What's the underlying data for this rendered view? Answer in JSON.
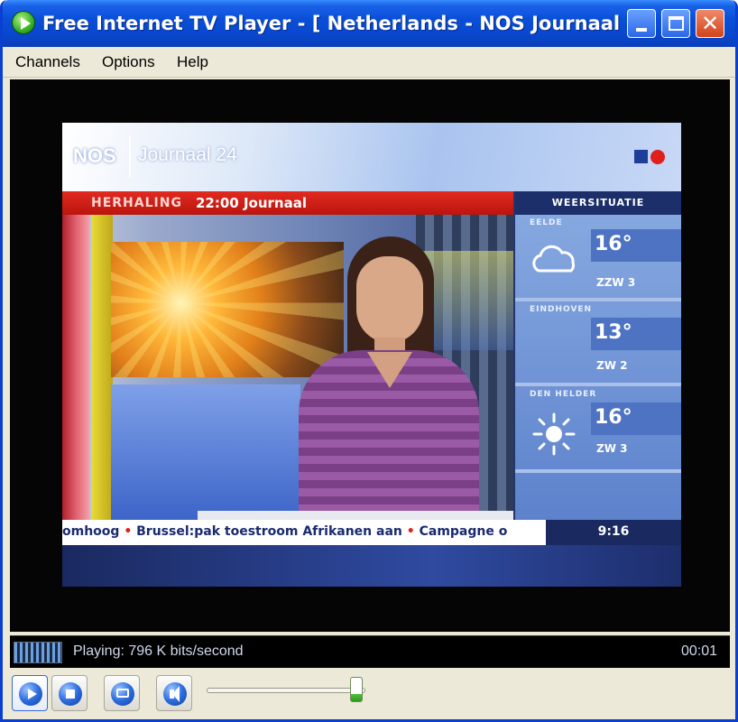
{
  "window": {
    "title": "Free Internet TV Player - [  Netherlands - NOS Journaal  (..."
  },
  "menu": {
    "items": [
      "Channels",
      "Options",
      "Help"
    ]
  },
  "broadcast": {
    "logo": "NOS",
    "channel_name": "Journaal 24",
    "banner_tag": "HERHALING",
    "banner_title": "22:00 Journaal",
    "weather_header": "WEERSITUATIE",
    "weather": [
      {
        "city": "EELDE",
        "temp": "16°",
        "wind": "ZZW 3",
        "icon": "cloud-icon"
      },
      {
        "city": "EINDHOVEN",
        "temp": "13°",
        "wind": "ZW 2",
        "icon": "none"
      },
      {
        "city": "DEN HELDER",
        "temp": "16°",
        "wind": "ZW 3",
        "icon": "sun-icon"
      }
    ],
    "ticker": [
      "omhoog",
      "Brussel:pak toestroom Afrikanen aan",
      "Campagne o"
    ],
    "ticker_separator": "•",
    "clock": "9:16"
  },
  "status": {
    "text": "Playing: 796 K bits/second",
    "elapsed": "00:01"
  },
  "controls": {
    "buttons": [
      "play-button",
      "stop-button",
      "fullscreen-button",
      "mute-button"
    ],
    "volume_level": 0.98
  },
  "colors": {
    "titlebar": "#0a4fd8",
    "nos_red": "#e0201a",
    "volume_green": "#2e9a20"
  }
}
